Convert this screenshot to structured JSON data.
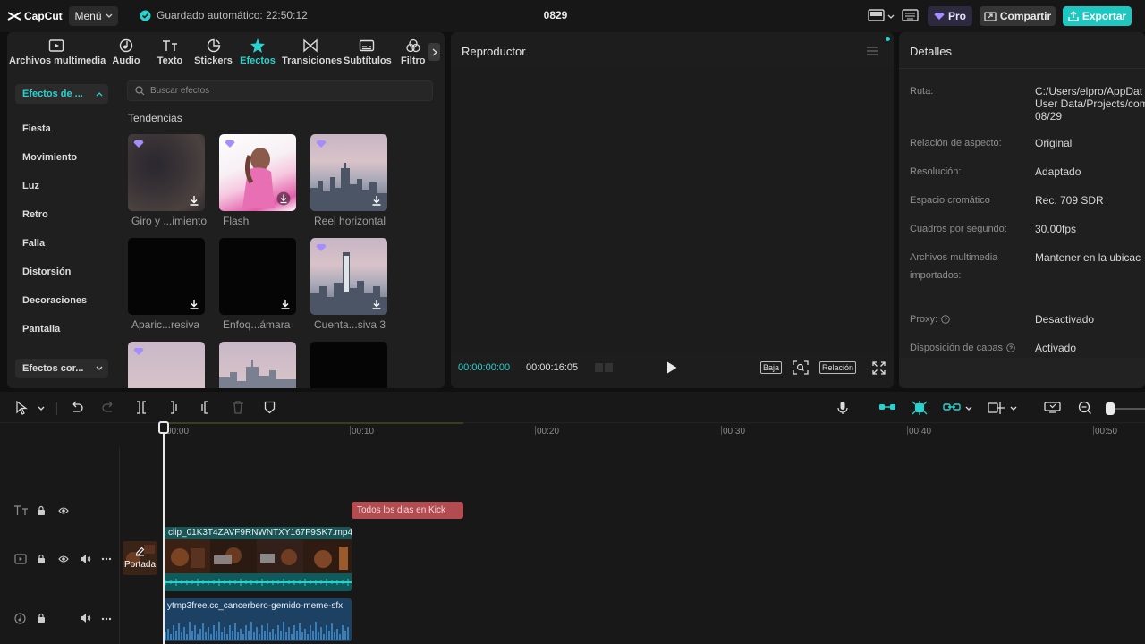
{
  "app": {
    "logo_text": "CapCut",
    "menu_label": "Menú",
    "autosave": "Guardado automático: 22:50:12",
    "project_title": "0829",
    "pro_label": "Pro",
    "share_label": "Compartir",
    "export_label": "Exportar",
    "accent_color": "#1fc7c1"
  },
  "tabs": [
    {
      "label": "Archivos multimedia",
      "icon": "media-icon"
    },
    {
      "label": "Audio",
      "icon": "audio-icon"
    },
    {
      "label": "Texto",
      "icon": "text-icon"
    },
    {
      "label": "Stickers",
      "icon": "sticker-icon"
    },
    {
      "label": "Efectos",
      "icon": "effects-icon",
      "active": true
    },
    {
      "label": "Transiciones",
      "icon": "transition-icon"
    },
    {
      "label": "Subtítulos",
      "icon": "subtitle-icon"
    },
    {
      "label": "Filtro",
      "icon": "filter-icon"
    }
  ],
  "sidebar": {
    "active_category": "Efectos de ...",
    "categories": [
      "Fiesta",
      "Movimiento",
      "Luz",
      "Retro",
      "Falla",
      "Distorsión",
      "Decoraciones",
      "Pantalla"
    ],
    "bottom_category": "Efectos cor..."
  },
  "search": {
    "placeholder": "Buscar efectos"
  },
  "effects": {
    "section_title": "Tendencias",
    "items": [
      {
        "label": "Giro y ...imiento"
      },
      {
        "label": "Flash"
      },
      {
        "label": "Reel horizontal"
      },
      {
        "label": "Aparic...resiva"
      },
      {
        "label": "Enfoq...ámara"
      },
      {
        "label": "Cuenta...siva 3"
      }
    ]
  },
  "player": {
    "title": "Reproductor",
    "time_current": "00:00:00:00",
    "time_total": "00:00:16:05",
    "quality_label": "Baja",
    "ratio_label": "Relación"
  },
  "details": {
    "title": "Detalles",
    "rows": [
      {
        "label": "Ruta:",
        "value_lines": [
          "C:/Users/elpro/AppDat",
          "User Data/Projects/com",
          "08/29"
        ]
      },
      {
        "label": "Relación de aspecto:",
        "value_lines": [
          "Original"
        ]
      },
      {
        "label": "Resolución:",
        "value_lines": [
          "Adaptado"
        ]
      },
      {
        "label": "Espacio cromático",
        "value_lines": [
          "Rec. 709 SDR"
        ]
      },
      {
        "label": "Cuadros por segundo:",
        "value_lines": [
          "30.00fps"
        ]
      },
      {
        "label": "Archivos multimedia importados:",
        "value_lines": [
          "Mantener en la ubicac"
        ]
      },
      {
        "label": "Proxy:",
        "value_lines": [
          "Desactivado"
        ]
      },
      {
        "label": "Disposición de capas",
        "value_lines": [
          "Activado"
        ]
      }
    ]
  },
  "timeline": {
    "ruler": [
      "00:00",
      "00:10",
      "00:20",
      "00:30",
      "00:40",
      "00:50"
    ],
    "text_clip": "Todos los dias en Kick",
    "video_clip": "clip_01K3T4ZAVF9RNWNTXY167F9SK7.mp4",
    "audio_clip": "ytmp3free.cc_cancerbero-gemido-meme-sfx",
    "cover_label": "Portada"
  }
}
